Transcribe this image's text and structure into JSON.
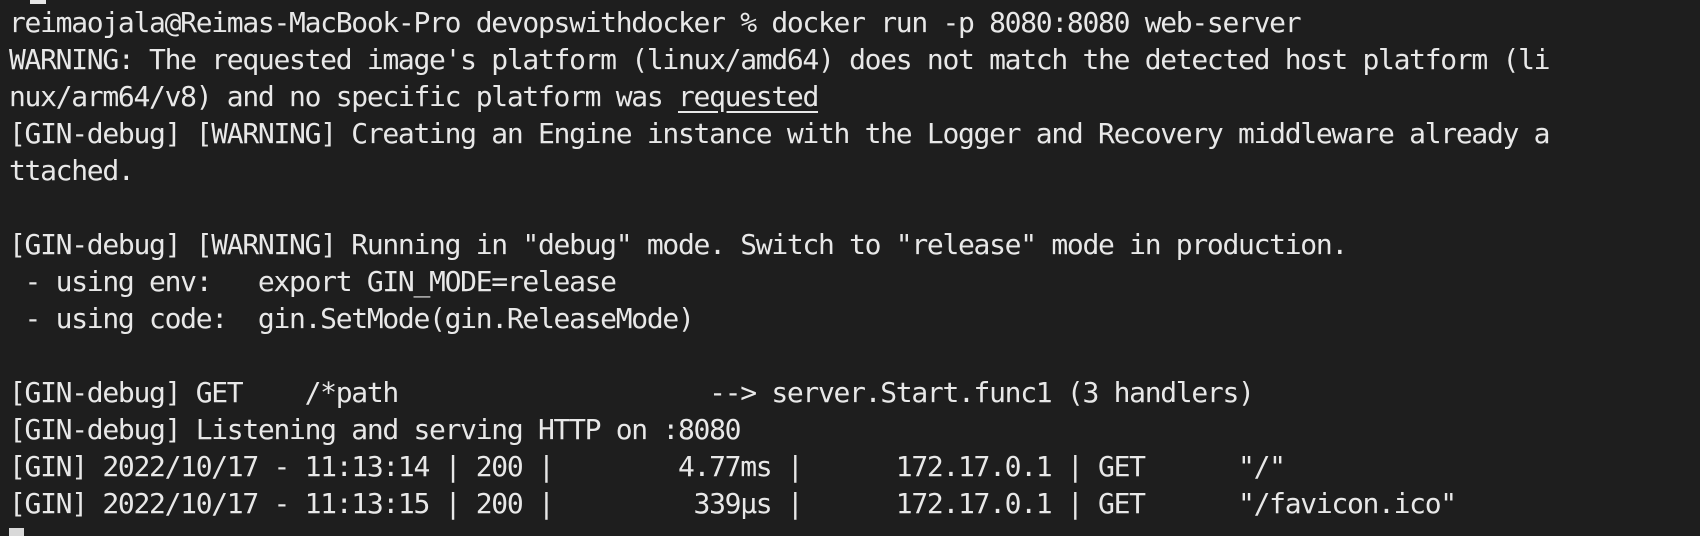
{
  "terminal": {
    "lines": [
      {
        "text": "reimaojala@Reimas-MacBook-Pro devopswithdocker % docker run -p 8080:8080 web-server"
      },
      {
        "text": "WARNING: The requested image's platform (linux/amd64) does not match the detected host platform (li"
      },
      {
        "text": "nux/arm64/v8) and no specific platform was ",
        "underlined": "requested"
      },
      {
        "text": "[GIN-debug] [WARNING] Creating an Engine instance with the Logger and Recovery middleware already a"
      },
      {
        "text": "ttached."
      },
      {
        "text": ""
      },
      {
        "text": "[GIN-debug] [WARNING] Running in \"debug\" mode. Switch to \"release\" mode in production."
      },
      {
        "text": " - using env:   export GIN_MODE=release"
      },
      {
        "text": " - using code:  gin.SetMode(gin.ReleaseMode)"
      },
      {
        "text": ""
      },
      {
        "text": "[GIN-debug] GET    /*path                    --> server.Start.func1 (3 handlers)"
      },
      {
        "text": "[GIN-debug] Listening and serving HTTP on :8080"
      },
      {
        "text": "[GIN] 2022/10/17 - 11:13:14 | 200 |        4.77ms |      172.17.0.1 | GET      \"/\""
      },
      {
        "text": "[GIN] 2022/10/17 - 11:13:15 | 200 |         339µs |      172.17.0.1 | GET      \"/favicon.ico\""
      },
      {
        "text": "",
        "cursor": true
      }
    ]
  }
}
